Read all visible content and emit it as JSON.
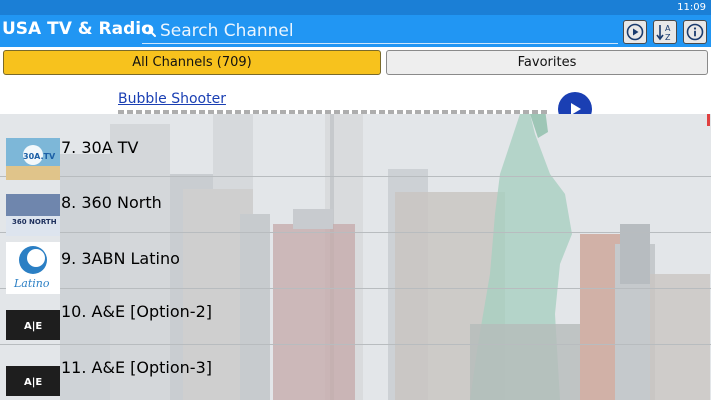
{
  "status_bar": {
    "time": "11:09"
  },
  "header": {
    "title": "USA TV & Radio",
    "search_placeholder": "Search Channel",
    "buttons": [
      {
        "icon": "play-circle-icon"
      },
      {
        "icon": "sort-az-icon",
        "letter_top": "A",
        "letter_bottom": "Z"
      },
      {
        "icon": "info-icon"
      }
    ]
  },
  "tabs": {
    "all_label": "All Channels (709)",
    "favorites_label": "Favorites"
  },
  "ad": {
    "title": "Bubble Shooter"
  },
  "channels": [
    {
      "name": "7. 30A TV",
      "logo_text": "30A.TV"
    },
    {
      "name": "8. 360 North",
      "logo_text": "360 NORTH"
    },
    {
      "name": "9. 3ABN Latino",
      "logo_text": "Latino"
    },
    {
      "name": "10. A&E [Option-2]",
      "logo_text": "A|E"
    },
    {
      "name": "11. A&E [Option-3]",
      "logo_text": "A|E"
    }
  ],
  "colors": {
    "header": "#2196f3",
    "status_bar": "#1b7fd6",
    "tab_active": "#f7c21d",
    "tab_inactive": "#eeeeee",
    "ad_link": "#1a3fb3"
  }
}
